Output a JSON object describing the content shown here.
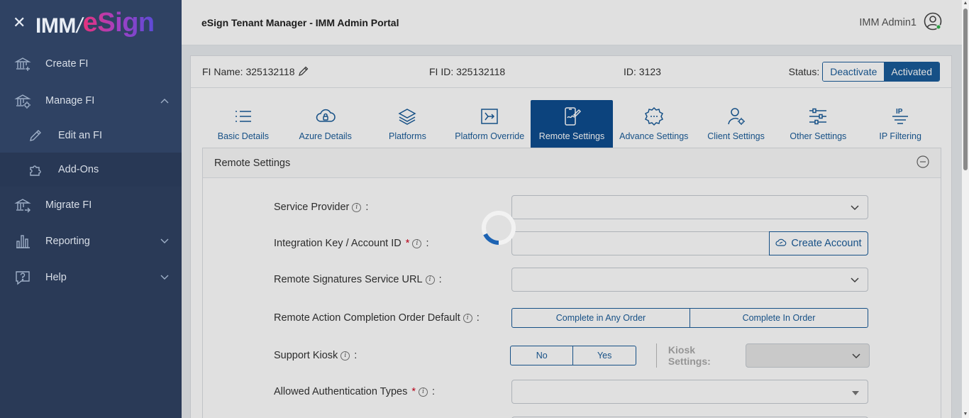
{
  "brand": {
    "imm": "IMM",
    "slash": "/",
    "esign": "eSign"
  },
  "sidebar": {
    "items": [
      {
        "label": "Create FI"
      },
      {
        "label": "Manage FI"
      },
      {
        "label": "Edit an FI"
      },
      {
        "label": "Add-Ons"
      },
      {
        "label": "Migrate FI"
      },
      {
        "label": "Reporting"
      },
      {
        "label": "Help"
      }
    ]
  },
  "header": {
    "title": "eSign Tenant Manager - IMM Admin Portal",
    "user": "IMM Admin1"
  },
  "fi": {
    "name_label": "FI Name: 325132118",
    "id_label": "FI ID: 325132118",
    "plain_id": "ID: 3123",
    "status_label": "Status:",
    "deactivate": "Deactivate",
    "activated": "Activated"
  },
  "tabs": [
    {
      "label": "Basic Details"
    },
    {
      "label": "Azure Details"
    },
    {
      "label": "Platforms"
    },
    {
      "label": "Platform Override"
    },
    {
      "label": "Remote Settings"
    },
    {
      "label": "Advance Settings"
    },
    {
      "label": "Client Settings"
    },
    {
      "label": "Other Settings"
    },
    {
      "label": "IP Filtering"
    }
  ],
  "panel": {
    "title": "Remote Settings",
    "service_provider": "Service Provider",
    "integration_key": "Integration Key / Account ID",
    "create_account": "Create Account",
    "remote_url": "Remote Signatures Service URL",
    "completion_order": "Remote Action Completion Order Default",
    "any_order": "Complete in Any Order",
    "in_order": "Complete In Order",
    "support_kiosk": "Support Kiosk",
    "no": "No",
    "yes": "Yes",
    "kiosk_settings": "Kiosk Settings:",
    "auth_types": "Allowed Authentication Types"
  },
  "colors": {
    "sidebar": "#2a3a57",
    "accent": "#1a5c99",
    "active_tab": "#0e4d8f"
  }
}
